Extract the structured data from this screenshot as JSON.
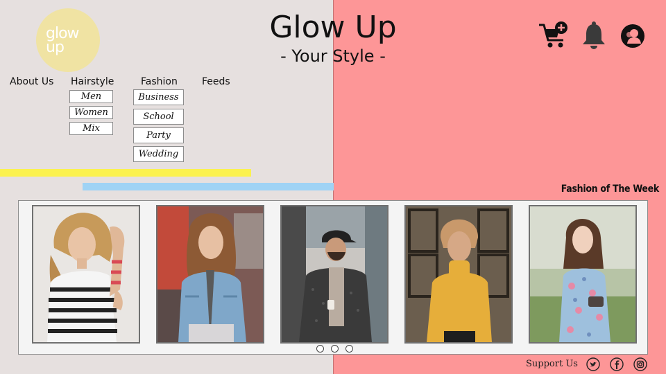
{
  "logo": {
    "line1": "glow",
    "line2": "up"
  },
  "header": {
    "title": "Glow Up",
    "tagline": "- Your Style -"
  },
  "icons": {
    "cart": "cart-plus-icon",
    "bell": "bell-icon",
    "user": "user-circle-icon"
  },
  "nav": {
    "about": "About Us",
    "hairstyle": {
      "label": "Hairstyle",
      "items": [
        "Men",
        "Women",
        "Mix"
      ]
    },
    "fashion": {
      "label": "Fashion",
      "items": [
        "Business",
        "School",
        "Party",
        "Wedding"
      ]
    },
    "feeds": "Feeds"
  },
  "section_title": "Fashion of The Week",
  "footer": {
    "support": "Support Us"
  },
  "colors": {
    "left_bg": "#e6e0df",
    "right_bg": "#fd9697",
    "yellow_bar": "#fbf24f",
    "blue_bar": "#9fd3f5",
    "logo_bg": "#f0e3a3"
  }
}
